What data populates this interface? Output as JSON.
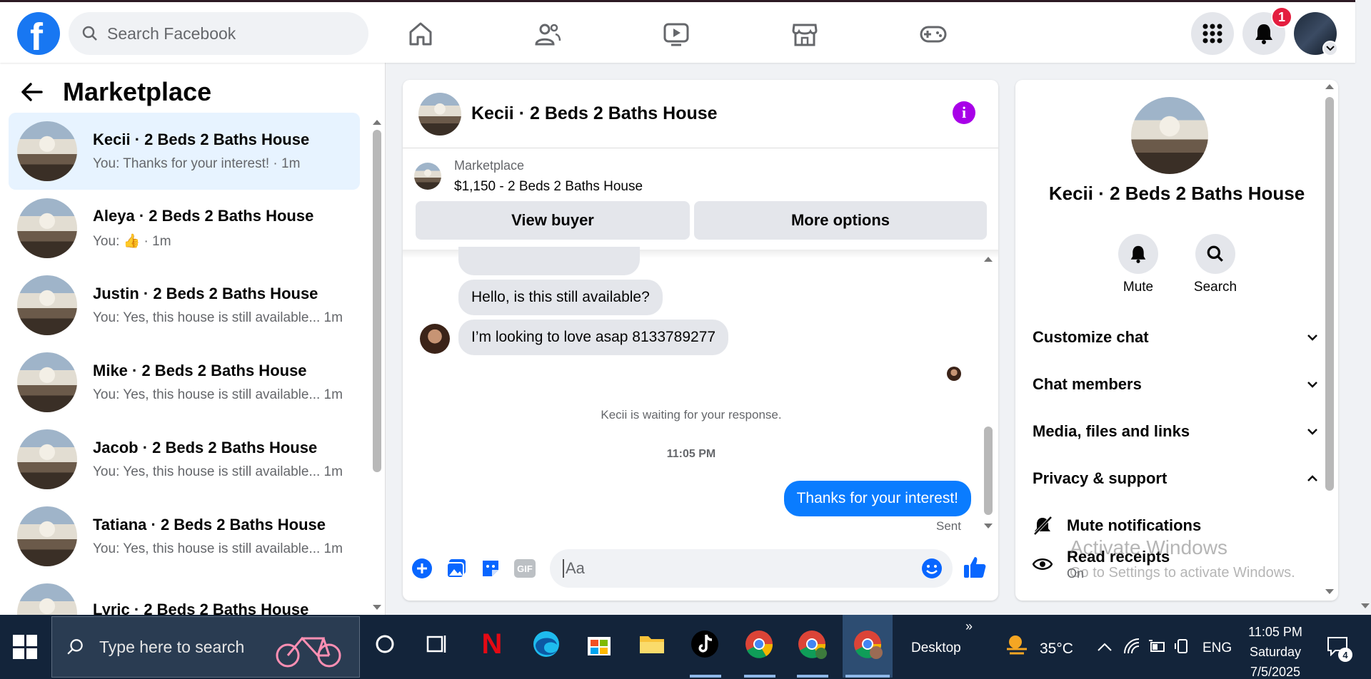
{
  "topbar": {
    "search_placeholder": "Search Facebook",
    "notification_count": "1"
  },
  "left": {
    "title": "Marketplace",
    "conversations": [
      {
        "name": "Kecii · 2 Beds 2 Baths House",
        "sub": "You: Thanks for your interest! · 1m"
      },
      {
        "name": "Aleya · 2 Beds 2 Baths House",
        "sub": "You: 👍 · 1m"
      },
      {
        "name": "Justin · 2 Beds 2 Baths House",
        "sub": "You: Yes, this house is still available...  1m"
      },
      {
        "name": "Mike · 2 Beds 2 Baths House",
        "sub": "You: Yes, this house is still available...  1m"
      },
      {
        "name": "Jacob · 2 Beds 2 Baths House",
        "sub": "You: Yes, this house is still available...  1m"
      },
      {
        "name": "Tatiana · 2 Beds 2 Baths House",
        "sub": "You: Yes, this house is still available...  1m"
      },
      {
        "name": "Lyric · 2 Beds 2 Baths House",
        "sub": ""
      }
    ]
  },
  "chat": {
    "title": "Kecii · 2 Beds 2 Baths House",
    "marketplace_label": "Marketplace",
    "item": "$1,150 - 2 Beds 2 Baths House",
    "view_buyer": "View buyer",
    "more_options": "More options",
    "msg1": "Hello, is this still available?",
    "msg2": "I’m looking to love asap 8133789277",
    "waiting": "Kecii is waiting for your response.",
    "time": "11:05 PM",
    "sent_msg": "Thanks for your interest!",
    "sent_status": "Sent",
    "input_placeholder": "Aa",
    "gif_label": "GIF"
  },
  "right": {
    "name": "Kecii · 2 Beds 2 Baths House",
    "mute": "Mute",
    "search": "Search",
    "customize": "Customize chat",
    "members": "Chat members",
    "media": "Media, files and links",
    "privacy": "Privacy & support",
    "mute_notifications": "Mute notifications",
    "read_receipts": "Read receipts",
    "read_receipts_state": "On"
  },
  "watermark": {
    "line1": "Activate Windows",
    "line2": "Go to Settings to activate Windows."
  },
  "taskbar": {
    "search_placeholder": "Type here to search",
    "desktop": "Desktop",
    "temperature": "35°C",
    "language": "ENG",
    "time": "11:05 PM",
    "day": "Saturday",
    "date": "7/5/2025",
    "notif_count": "4"
  }
}
